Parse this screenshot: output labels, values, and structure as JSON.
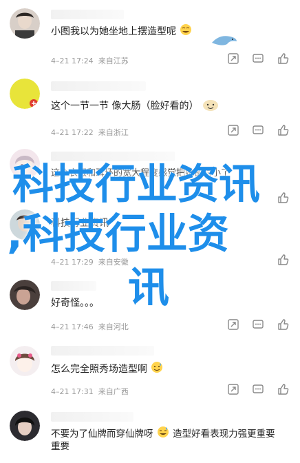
{
  "comments": [
    {
      "text": "小图我以为她坐地上摆造型呢",
      "time": "4–21 17:24",
      "location": "来自江苏"
    },
    {
      "text": "这个一节一节 像大肠（脸好看的）",
      "time": "4–21 17:22",
      "location": "来自浙江"
    },
    {
      "text": "这个衣服和耳环的宽大程度感觉把她都衬小了",
      "time": "",
      "location": ""
    },
    {
      "text": "科技行业资讯",
      "time": "4–21 17:29",
      "location": "来自安徽"
    },
    {
      "text": "好奇怪。。。",
      "time": "4–21 17:46",
      "location": "来自河北"
    },
    {
      "text": "怎么完全照秀场造型啊",
      "time": "4–21 17:31",
      "location": "来自广西"
    },
    {
      "text": "不要为了仙牌而穿仙牌呀",
      "text2": "造型好看表现力强更重要",
      "line2": "重要",
      "time": "",
      "location": ""
    }
  ],
  "overlay": {
    "line1": "科技行业资讯",
    "line2": ",科技行业资",
    "line3": "讯"
  },
  "colors": {
    "overlay": "#1e8eea",
    "meta": "#9a9a9a",
    "text": "#222222"
  },
  "icons": {
    "share": "share-icon",
    "comment": "comment-icon",
    "like": "thumb-up-icon"
  }
}
